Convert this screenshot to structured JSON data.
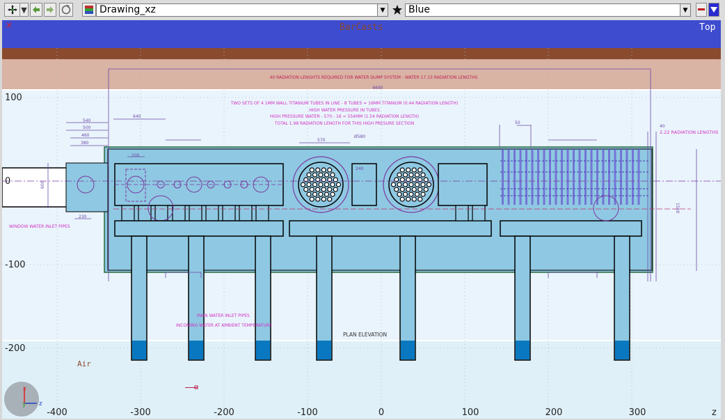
{
  "toolbar": {
    "drawing_name": "Drawing_xz",
    "color_name": "Blue",
    "icons": [
      "move-tool-icon",
      "dropdown-arrow-icon",
      "back-arrow-icon",
      "forward-arrow-icon",
      "refresh-icon",
      "layers-icon",
      "star-icon",
      "minimize-icon",
      "dropdown-arrow-icon"
    ]
  },
  "banner": {
    "title": "BarCasts",
    "view_label": "Top",
    "close_glyph": "×"
  },
  "axes": {
    "y_ticks": [
      "100",
      "0",
      "-100",
      "-200"
    ],
    "x_ticks": [
      "-400",
      "-300",
      "-200",
      "-100",
      "0",
      "100",
      "200",
      "300"
    ],
    "corner_z": "z",
    "gizmo_x": "x",
    "gizmo_y": "y",
    "gizmo_z": "z"
  },
  "drawing": {
    "top_dim": "6690",
    "radiation_note": "40 RADIATION LENGHTS REQUIRED FOR WATER DUMP SYSTEM - WATER 17.13 RADIATION LENGTHS",
    "tubes_note": {
      "line1": "TWO SETS OF 4 1MM WALL TITANIUM TUBES IN LINE - 8 TUBES = 16MM TITANIUM (0.44 RADIATION LENGTH)",
      "line2": "HIGH WATER PRESSURE IN TUBES",
      "line3": "HIGH PRESSURE WATER - 570 - 16 = 554MM (1.54 RADIATION LENGTH)",
      "line4": "TOTAL 1.98 RADIATION LENGTH FOR THIS HIGH PRESURE SECTION"
    },
    "dims": {
      "d540": "540",
      "d500": "500",
      "d460": "460",
      "d380": "380",
      "d640": "640",
      "d200": "200",
      "d570": "570",
      "d580": "Ø580",
      "d240": "240",
      "d50": "50",
      "d40": "40",
      "d600": "600",
      "d230": "230",
      "d1500": "1500"
    },
    "right_note": "2.22 RADIATION LENGTHS",
    "window_note": "WINDOW WATER INLET PIPES",
    "main_note_1": "MAIN WATER INLET PIPES",
    "main_note_2": "INCOMING WATER AT AMBIENT TEMPERATURE",
    "plan_label": "PLAN ELEVATION",
    "air_label": "Air"
  }
}
